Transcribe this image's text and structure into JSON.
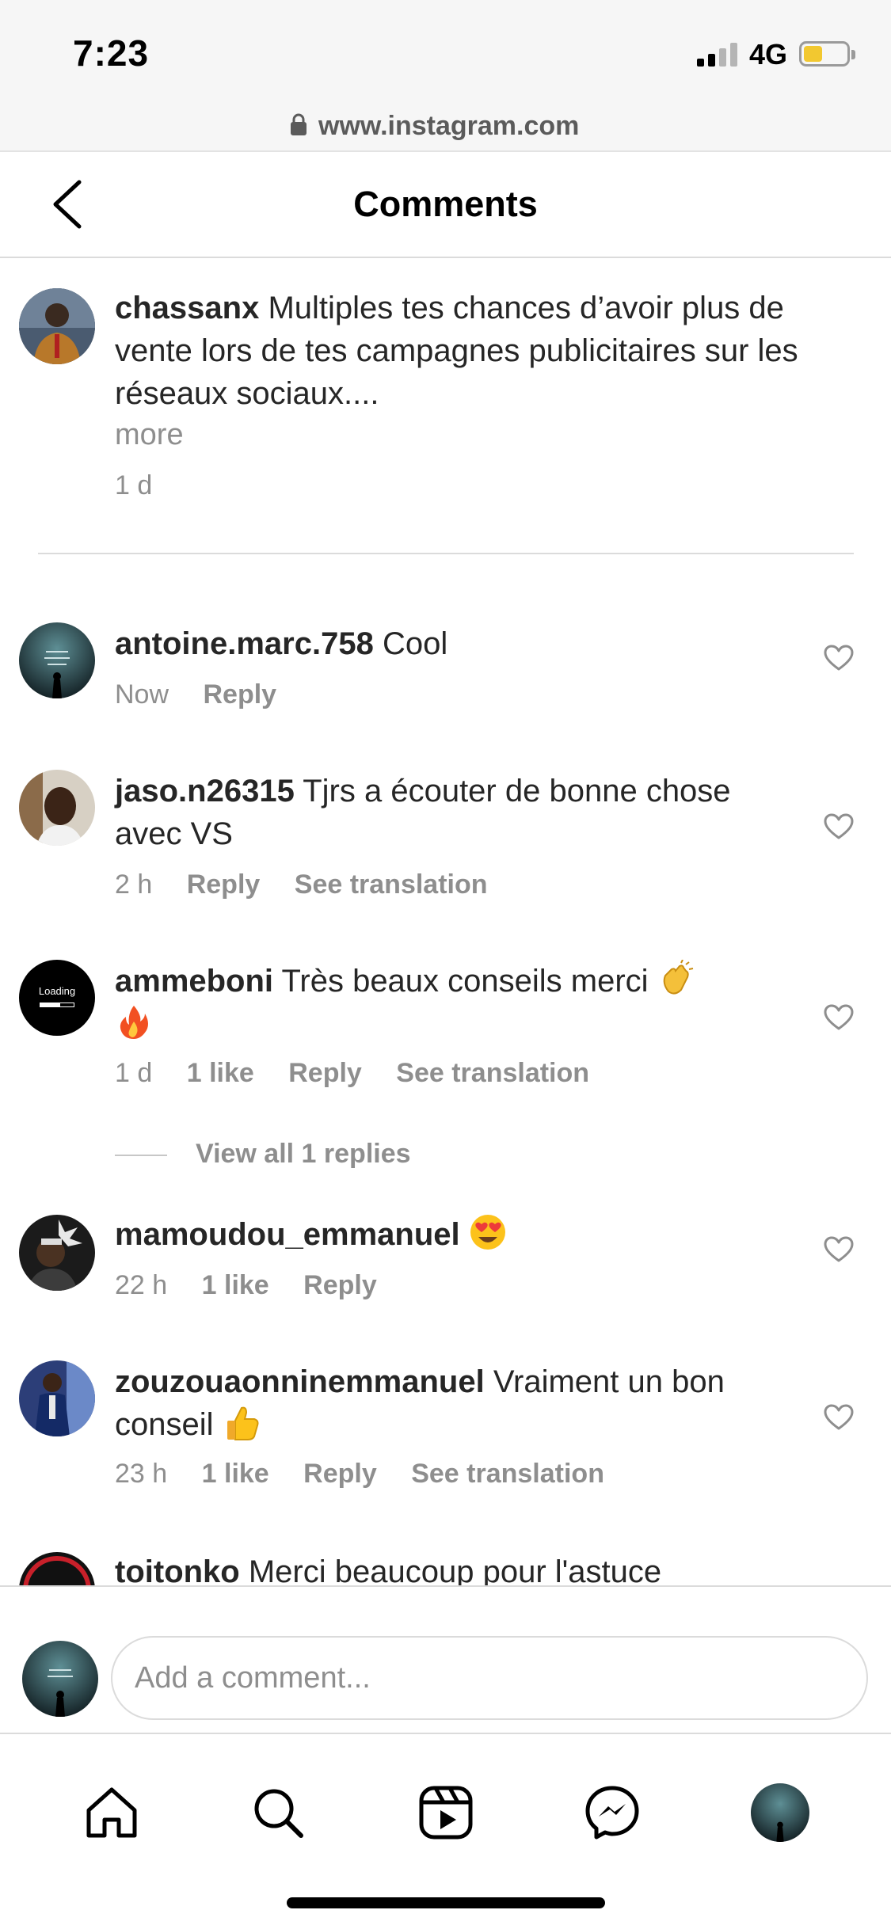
{
  "status_bar": {
    "time": "7:23",
    "network": "4G",
    "battery_level": 0.45
  },
  "browser": {
    "url": "www.instagram.com"
  },
  "header": {
    "title": "Comments"
  },
  "caption": {
    "username": "chassanx",
    "text": "Multiples tes chances d’avoir plus de vente lors de tes campagnes publicitaires sur les réseaux sociaux....",
    "more": "more",
    "time": "1 d"
  },
  "comments": [
    {
      "username": "antoine.marc.758",
      "text": "Cool",
      "time": "Now",
      "likes": "",
      "reply": "Reply",
      "translate": ""
    },
    {
      "username": "jaso.n26315",
      "text": "Tjrs a écouter de bonne chose avec VS",
      "time": "2 h",
      "likes": "",
      "reply": "Reply",
      "translate": "See translation"
    },
    {
      "username": "ammeboni",
      "text": "Très beaux conseils merci",
      "time": "1 d",
      "likes": "1 like",
      "reply": "Reply",
      "translate": "See translation",
      "avatar_text": "Loading"
    },
    {
      "username": "mamoudou_emmanuel",
      "text": "",
      "time": "22 h",
      "likes": "1 like",
      "reply": "Reply",
      "translate": ""
    },
    {
      "username": "zouzouaonninemmanuel",
      "text": "Vraiment un bon conseil",
      "time": "23 h",
      "likes": "1 like",
      "reply": "Reply",
      "translate": "See translation"
    },
    {
      "username": "toitonko",
      "text": "Merci beaucoup pour l'astuce"
    }
  ],
  "view_replies": "View all 1 replies",
  "add_comment": {
    "placeholder": "Add a comment..."
  },
  "nav": [
    "home-icon",
    "search-icon",
    "reels-icon",
    "messenger-icon",
    "profile-avatar"
  ],
  "colors": {
    "text": "#262626",
    "muted": "#8e8e8e",
    "divider": "#dbdbdb",
    "battery": "#f2c830"
  }
}
